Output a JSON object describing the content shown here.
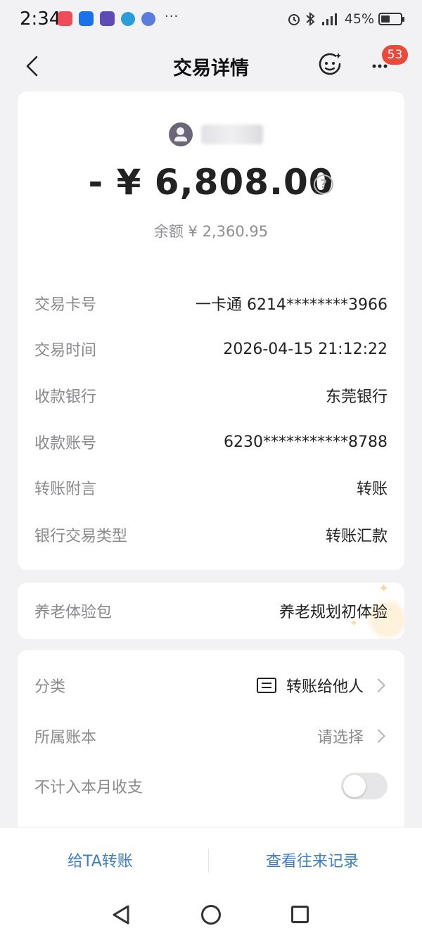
{
  "status_bar": {
    "time": "2:34",
    "more_notifications": "···",
    "battery_percent": "45%",
    "battery_level": 0.45,
    "icons": [
      "red-app-icon",
      "blue-app-icon",
      "tieba-icon",
      "telegram-icon",
      "music-icon",
      "alarm-icon",
      "bluetooth-icon",
      "signal-icon",
      "battery-icon"
    ]
  },
  "header": {
    "title": "交易详情",
    "notification_count": "53"
  },
  "transaction": {
    "amount": "- ¥ 6,808.00",
    "help_symbol": "?",
    "balance": "余额 ¥ 2,360.95",
    "details": [
      {
        "label": "交易卡号",
        "value": "一卡通 6214********3966"
      },
      {
        "label": "交易时间",
        "value": "2026-04-15 21:12:22"
      },
      {
        "label": "收款银行",
        "value": "东莞银行"
      },
      {
        "label": "收款账号",
        "value": "6230***********8788"
      },
      {
        "label": "转账附言",
        "value": "转账"
      },
      {
        "label": "银行交易类型",
        "value": "转账汇款"
      }
    ]
  },
  "pension": {
    "label": "养老体验包",
    "value": "养老规划初体验"
  },
  "ledger": {
    "category_label": "分类",
    "category_value": "转账给他人",
    "book_label": "所属账本",
    "book_placeholder": "请选择",
    "exclude_label": "不计入本月收支",
    "exclude_enabled": false
  },
  "actions": {
    "transfer": "给TA转账",
    "history": "查看往来记录"
  },
  "colors": {
    "background": "#f2f2f4",
    "link_blue": "#3d7fc4",
    "badge_red": "#ea4a3a",
    "label_gray": "#8a8a8e"
  }
}
